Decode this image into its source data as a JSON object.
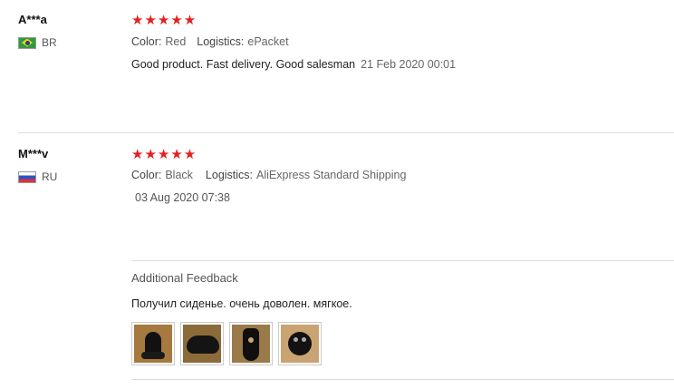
{
  "reviews": [
    {
      "user": "A***a",
      "country": "BR",
      "stars": "★★★★★",
      "color_label": "Color:",
      "color_value": "Red",
      "logistics_label": "Logistics:",
      "logistics_value": "ePacket",
      "text": "Good product. Fast delivery. Good salesman",
      "date": "21 Feb 2020 00:01"
    },
    {
      "user": "M***v",
      "country": "RU",
      "stars": "★★★★★",
      "color_label": "Color:",
      "color_value": "Black",
      "logistics_label": "Logistics:",
      "logistics_value": "AliExpress Standard Shipping",
      "date": "03 Aug 2020 07:38",
      "additional_title": "Additional Feedback",
      "additional_text": "Получил сиденье. очень доволен. мягкое.",
      "photo_count": 4
    }
  ],
  "colors": {
    "star": "#e5201f",
    "divider": "#dcdcdc"
  }
}
